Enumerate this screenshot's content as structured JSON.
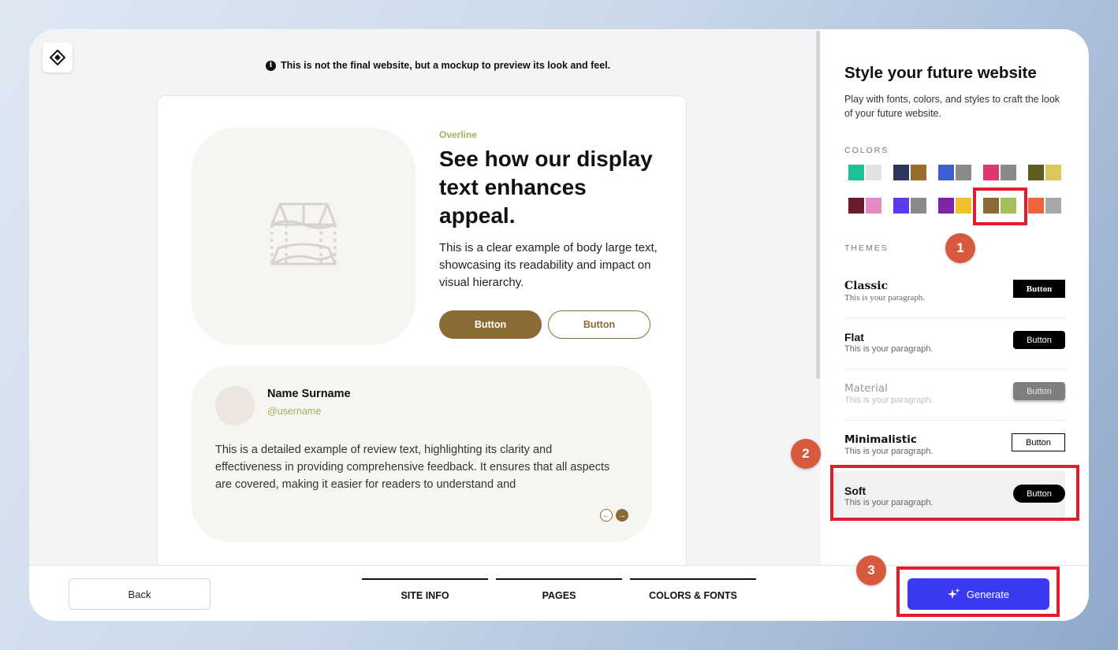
{
  "notice": "This is not the final website, but a mockup to preview its look and feel.",
  "mockup": {
    "overline": "Overline",
    "display_text": "See how our display text enhances appeal.",
    "body_large": "This is a clear example of body large text, showcasing its readability and impact on visual hierarchy.",
    "button_primary": "Button",
    "button_secondary": "Button",
    "review": {
      "name": "Name Surname",
      "username": "@username",
      "text": "This is a detailed example of review text, highlighting its clarity and effectiveness in providing comprehensive feedback. It ensures that all aspects are covered, making it easier for readers to understand and"
    }
  },
  "panel": {
    "title": "Style your future website",
    "subtitle": "Play with fonts, colors, and styles to craft the look of your future website.",
    "colors_label": "COLORS",
    "themes_label": "THEMES",
    "palettes": [
      [
        "#1fbf9a",
        "#e2e2e2"
      ],
      [
        "#2e3560",
        "#9a6d2b"
      ],
      [
        "#3f5fd0",
        "#8a8a8a"
      ],
      [
        "#e0356e",
        "#8a8a8a"
      ],
      [
        "#5e5e24",
        "#dcc75a"
      ],
      [
        "#6b1c2c",
        "#e58ac4"
      ],
      [
        "#5b3af0",
        "#8a8a8a"
      ],
      [
        "#7d24a8",
        "#f0c02e"
      ],
      [
        "#8b6b35",
        "#a2c05a"
      ],
      [
        "#f0643a",
        "#a8a8a8"
      ]
    ],
    "selected_palette": 8,
    "themes": [
      {
        "name": "Classic",
        "paragraph": "This is your paragraph.",
        "button": "Button"
      },
      {
        "name": "Flat",
        "paragraph": "This is your paragraph.",
        "button": "Button"
      },
      {
        "name": "Material",
        "paragraph": "This is your paragraph.",
        "button": "Button"
      },
      {
        "name": "Minimalistic",
        "paragraph": "This is your paragraph.",
        "button": "Button"
      },
      {
        "name": "Soft",
        "paragraph": "This is your paragraph.",
        "button": "Button"
      }
    ],
    "selected_theme": "Soft"
  },
  "footer": {
    "back": "Back",
    "steps": [
      "SITE INFO",
      "PAGES",
      "COLORS & FONTS"
    ],
    "generate": "Generate"
  },
  "annotations": [
    "1",
    "2",
    "3"
  ],
  "colors": {
    "accent": "#8b6b35",
    "accent_light": "#9ab65a",
    "generate": "#3a3af0",
    "highlight": "#e11d2b",
    "badge": "#d85a3e"
  }
}
